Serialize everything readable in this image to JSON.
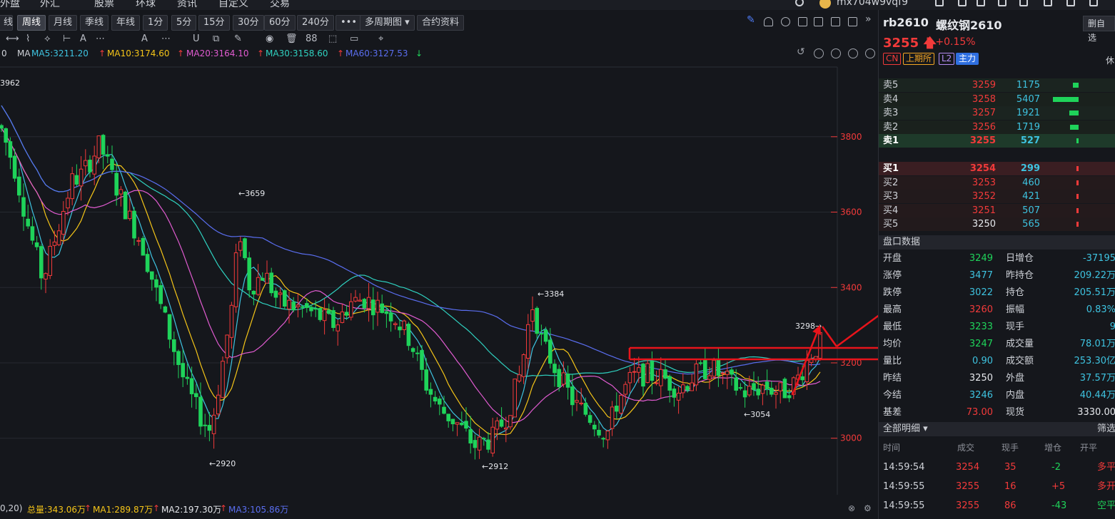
{
  "top_menu": {
    "items": [
      "外盘",
      "外汇",
      "股票",
      "环球",
      "资讯",
      "自定义",
      "交易"
    ],
    "username": "mx704w9vqf9"
  },
  "toolbar": {
    "periods": [
      "线",
      "周线",
      "月线",
      "季线",
      "年线",
      "1分",
      "5分",
      "15分",
      "30分",
      "60分",
      "240分",
      "•••",
      "多周期图 ▾",
      "合约资料"
    ],
    "active_period": "周线"
  },
  "draw_tools": [
    "⟷",
    "⌇",
    "⟡",
    "⊢",
    "A",
    "⋯",
    "U",
    "⧉",
    "✎",
    "◉",
    "🗑",
    "88",
    "⬚",
    "▭",
    "⌖"
  ],
  "ma_legend": {
    "prefix": "0",
    "ma_label": "MA",
    "ma5": "MA5:3211.20",
    "ma10": "MA10:3174.60",
    "ma20": "MA20:3164.10",
    "ma30": "MA30:3158.60",
    "ma60": "MA60:3127.53",
    "colors": {
      "ma5": "#3ec3e0",
      "ma10": "#f5c518",
      "ma20": "#e05bd0",
      "ma30": "#2fd1c0",
      "ma60": "#5a6ef0"
    }
  },
  "chart_data": {
    "type": "candlestick",
    "y_axis": {
      "ticks": [
        3000,
        3200,
        3400,
        3600,
        3800
      ],
      "min": 2850,
      "max": 3985
    },
    "annotations": [
      {
        "text": "3962",
        "kind": "high"
      },
      {
        "text": "←3659",
        "kind": "high"
      },
      {
        "text": "←2920",
        "kind": "low"
      },
      {
        "text": "←3384",
        "kind": "high"
      },
      {
        "text": "←2912",
        "kind": "low"
      },
      {
        "text": "←3054",
        "kind": "low"
      },
      {
        "text": "3298→",
        "kind": "high"
      }
    ],
    "up_color": "#f23a3a",
    "down_color": "#1fd35a"
  },
  "volume_legend": {
    "prefix": "0,20)",
    "total": "总量:343.06万",
    "ma1": "MA1:289.87万",
    "ma2": "MA2:197.30万",
    "ma3": "MA3:105.86万"
  },
  "right_panel": {
    "symbol": "rb2610",
    "name": "螺纹钢2610",
    "delete_label": "删自选",
    "price": "3255",
    "change": "5  +0.15%",
    "tags": [
      "CN",
      "上期所",
      "L2",
      "主力"
    ],
    "rest_label": "休",
    "asks": [
      {
        "label": "卖5",
        "price": "3259",
        "qty": "1175",
        "bar": 0.13
      },
      {
        "label": "卖4",
        "price": "3258",
        "qty": "5407",
        "bar": 0.62
      },
      {
        "label": "卖3",
        "price": "3257",
        "qty": "1921",
        "bar": 0.22
      },
      {
        "label": "卖2",
        "price": "3256",
        "qty": "1719",
        "bar": 0.2
      },
      {
        "label": "卖1",
        "price": "3255",
        "qty": "527",
        "bar": 0.06
      }
    ],
    "bids": [
      {
        "label": "买1",
        "price": "3254",
        "qty": "299",
        "bar": 0.03
      },
      {
        "label": "买2",
        "price": "3253",
        "qty": "460",
        "bar": 0.05
      },
      {
        "label": "买3",
        "price": "3252",
        "qty": "421",
        "bar": 0.05
      },
      {
        "label": "买4",
        "price": "3251",
        "qty": "507",
        "bar": 0.06
      },
      {
        "label": "买5",
        "price": "3250",
        "qty": "565",
        "bar": 0.06
      }
    ],
    "market_header": "盘口数据",
    "market_data": [
      {
        "k1": "开盘",
        "v1": "3249",
        "c1": "#1fd35a",
        "k2": "日增仓",
        "v2": "-37195",
        "c2": "#3ec3e0"
      },
      {
        "k1": "涨停",
        "v1": "3477",
        "c1": "#3ec3e0",
        "k2": "昨持仓",
        "v2": "209.22万",
        "c2": "#3ec3e0"
      },
      {
        "k1": "跌停",
        "v1": "3022",
        "c1": "#3ec3e0",
        "k2": "持仓",
        "v2": "205.51万",
        "c2": "#3ec3e0"
      },
      {
        "k1": "最高",
        "v1": "3260",
        "c1": "#f23a3a",
        "k2": "振幅",
        "v2": "0.83%",
        "c2": "#3ec3e0"
      },
      {
        "k1": "最低",
        "v1": "3233",
        "c1": "#1fd35a",
        "k2": "现手",
        "v2": "9",
        "c2": "#3ec3e0"
      },
      {
        "k1": "均价",
        "v1": "3247",
        "c1": "#1fd35a",
        "k2": "成交量",
        "v2": "78.01万",
        "c2": "#3ec3e0"
      },
      {
        "k1": "量比",
        "v1": "0.90",
        "c1": "#3ec3e0",
        "k2": "成交额",
        "v2": "253.30亿",
        "c2": "#3ec3e0"
      },
      {
        "k1": "昨结",
        "v1": "3250",
        "c1": "#e6e8ec",
        "k2": "外盘",
        "v2": "37.57万",
        "c2": "#3ec3e0"
      },
      {
        "k1": "今结",
        "v1": "3246",
        "c1": "#3ec3e0",
        "k2": "内盘",
        "v2": "40.44万",
        "c2": "#3ec3e0"
      },
      {
        "k1": "基差",
        "v1": "73.00",
        "c1": "#f23a3a",
        "k2": "现货",
        "v2": "3330.00",
        "c2": "#e6e8ec"
      }
    ],
    "detail_header": "全部明细 ▾",
    "detail_filter": "筛选",
    "detail_columns": [
      "时间",
      "成交",
      "现手",
      "增仓",
      "开平"
    ],
    "ticks": [
      {
        "time": "14:59:54",
        "price": "3254",
        "qty": "35",
        "chg": "-2",
        "chg_color": "#1fd35a",
        "type": "多平"
      },
      {
        "time": "14:59:55",
        "price": "3255",
        "qty": "16",
        "chg": "+5",
        "chg_color": "#f23a3a",
        "type": "多开"
      },
      {
        "time": "14:59:55",
        "price": "3255",
        "qty": "86",
        "chg": "-43",
        "chg_color": "#1fd35a",
        "type": "空平"
      }
    ]
  }
}
